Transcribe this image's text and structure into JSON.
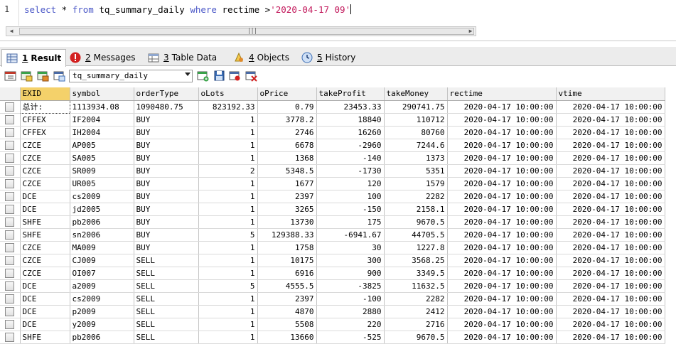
{
  "editor": {
    "line_number": "1",
    "sql": {
      "select": "select",
      "star": " * ",
      "from": "from",
      "table": " tq_summary_daily ",
      "where": "where",
      "condition": " rectime >",
      "literal": "'2020-04-17 09'"
    },
    "scroll_grip": "|||"
  },
  "tabs": [
    {
      "num": "1",
      "label": "Result"
    },
    {
      "num": "2",
      "label": "Messages"
    },
    {
      "num": "3",
      "label": "Table Data"
    },
    {
      "num": "4",
      "label": "Objects"
    },
    {
      "num": "5",
      "label": "History"
    }
  ],
  "toolbar": {
    "table_select": "tq_summary_daily"
  },
  "grid": {
    "columns": [
      "EXID",
      "symbol",
      "orderType",
      "oLots",
      "oPrice",
      "takeProfit",
      "takeMoney",
      "rectime",
      "vtime"
    ],
    "rows": [
      [
        "总计:",
        "1113934.08",
        "1090480.75",
        "823192.33",
        "0.79",
        "23453.33",
        "290741.75",
        "2020-04-17 10:00:00",
        "2020-04-17 10:00:00"
      ],
      [
        "CFFEX",
        "IF2004",
        "BUY",
        "1",
        "3778.2",
        "18840",
        "110712",
        "2020-04-17 10:00:00",
        "2020-04-17 10:00:00"
      ],
      [
        "CFFEX",
        "IH2004",
        "BUY",
        "1",
        "2746",
        "16260",
        "80760",
        "2020-04-17 10:00:00",
        "2020-04-17 10:00:00"
      ],
      [
        "CZCE",
        "AP005",
        "BUY",
        "1",
        "6678",
        "-2960",
        "7244.6",
        "2020-04-17 10:00:00",
        "2020-04-17 10:00:00"
      ],
      [
        "CZCE",
        "SA005",
        "BUY",
        "1",
        "1368",
        "-140",
        "1373",
        "2020-04-17 10:00:00",
        "2020-04-17 10:00:00"
      ],
      [
        "CZCE",
        "SR009",
        "BUY",
        "2",
        "5348.5",
        "-1730",
        "5351",
        "2020-04-17 10:00:00",
        "2020-04-17 10:00:00"
      ],
      [
        "CZCE",
        "UR005",
        "BUY",
        "1",
        "1677",
        "120",
        "1579",
        "2020-04-17 10:00:00",
        "2020-04-17 10:00:00"
      ],
      [
        "DCE",
        "cs2009",
        "BUY",
        "1",
        "2397",
        "100",
        "2282",
        "2020-04-17 10:00:00",
        "2020-04-17 10:00:00"
      ],
      [
        "DCE",
        "jd2005",
        "BUY",
        "1",
        "3265",
        "-150",
        "2158.1",
        "2020-04-17 10:00:00",
        "2020-04-17 10:00:00"
      ],
      [
        "SHFE",
        "pb2006",
        "BUY",
        "1",
        "13730",
        "175",
        "9670.5",
        "2020-04-17 10:00:00",
        "2020-04-17 10:00:00"
      ],
      [
        "SHFE",
        "sn2006",
        "BUY",
        "5",
        "129388.33",
        "-6941.67",
        "44705.5",
        "2020-04-17 10:00:00",
        "2020-04-17 10:00:00"
      ],
      [
        "CZCE",
        "MA009",
        "BUY",
        "1",
        "1758",
        "30",
        "1227.8",
        "2020-04-17 10:00:00",
        "2020-04-17 10:00:00"
      ],
      [
        "CZCE",
        "CJ009",
        "SELL",
        "1",
        "10175",
        "300",
        "3568.25",
        "2020-04-17 10:00:00",
        "2020-04-17 10:00:00"
      ],
      [
        "CZCE",
        "OI007",
        "SELL",
        "1",
        "6916",
        "900",
        "3349.5",
        "2020-04-17 10:00:00",
        "2020-04-17 10:00:00"
      ],
      [
        "DCE",
        "a2009",
        "SELL",
        "5",
        "4555.5",
        "-3825",
        "11632.5",
        "2020-04-17 10:00:00",
        "2020-04-17 10:00:00"
      ],
      [
        "DCE",
        "cs2009",
        "SELL",
        "1",
        "2397",
        "-100",
        "2282",
        "2020-04-17 10:00:00",
        "2020-04-17 10:00:00"
      ],
      [
        "DCE",
        "p2009",
        "SELL",
        "1",
        "4870",
        "2880",
        "2412",
        "2020-04-17 10:00:00",
        "2020-04-17 10:00:00"
      ],
      [
        "DCE",
        "y2009",
        "SELL",
        "1",
        "5508",
        "220",
        "2716",
        "2020-04-17 10:00:00",
        "2020-04-17 10:00:00"
      ],
      [
        "SHFE",
        "pb2006",
        "SELL",
        "1",
        "13660",
        "-525",
        "9670.5",
        "2020-04-17 10:00:00",
        "2020-04-17 10:00:00"
      ]
    ]
  }
}
